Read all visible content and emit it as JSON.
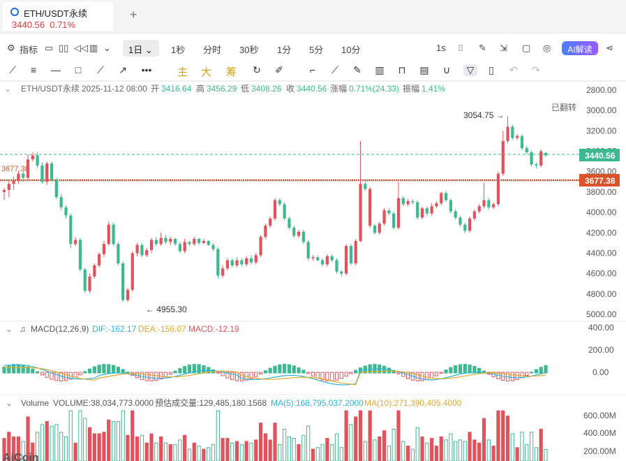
{
  "tab": {
    "title": "ETH/USDT永续",
    "price": "3440.56",
    "change": "0.71%",
    "add": "+"
  },
  "toolbar": {
    "indicators": "指标",
    "day": "1日",
    "intervals": [
      "1秒",
      "分时",
      "30秒",
      "1分",
      "5分",
      "10分"
    ],
    "sec": "1s",
    "ai": "AI解读"
  },
  "drawing": {
    "chars": [
      "主",
      "大",
      "筹"
    ]
  },
  "info": {
    "symbol": "ETH/USDT永续",
    "date": "2025-11-12 08:00",
    "open_l": "开",
    "open": "3416.64",
    "high_l": "高",
    "high": "3456.29",
    "low_l": "低",
    "low": "3408.26",
    "close_l": "收",
    "close": "3440.56",
    "chg_l": "涨幅",
    "chg": "0.71%(24.33)",
    "amp_l": "振幅",
    "amp": "1.41%",
    "flipped": "已翻转"
  },
  "price_axis": [
    "2800.00",
    "3000.00",
    "3200.00",
    "3400.00",
    "3600.00",
    "3800.00",
    "4000.00",
    "4200.00",
    "4400.00",
    "4600.00",
    "4800.00",
    "5000.00"
  ],
  "price_last": "3440.56",
  "price_line": "3677.38",
  "left_line": "3677.38",
  "markers": {
    "high": "3054.75",
    "low": "4955.30"
  },
  "macd": {
    "title": "MACD(12,26,9)",
    "dif": "DIF:-162.17",
    "dea": "DEA:-156.07",
    "macd": "MACD:-12.19",
    "axis": [
      "400.00",
      "200.00",
      "0.00"
    ]
  },
  "volume": {
    "title": "Volume",
    "vol": "VOLUME:38,034,773.0000",
    "est": "预估成交量:129,485,180.1568",
    "ma5": "MA(5):168,795,037.2000",
    "ma10": "MA(10):271,390,405.4000",
    "axis": [
      "600.00M",
      "400.00M",
      "200.00M"
    ]
  },
  "watermark": "AiCoin",
  "colors": {
    "up": "#e0535d",
    "down": "#3eb891",
    "accent": "#d9542b",
    "dif": "#29b6d6",
    "dea": "#e0a92a"
  },
  "chart_data": {
    "type": "candlestick",
    "ylim": [
      2800,
      5000
    ],
    "inverted": true,
    "candles": [
      [
        3800,
        3780,
        3880,
        3760,
        1
      ],
      [
        3780,
        3720,
        3850,
        3690,
        1
      ],
      [
        3720,
        3690,
        3780,
        3650,
        1
      ],
      [
        3690,
        3620,
        3720,
        3590,
        1
      ],
      [
        3620,
        3660,
        3700,
        3600,
        0
      ],
      [
        3660,
        3480,
        3690,
        3430,
        1
      ],
      [
        3480,
        3440,
        3500,
        3410,
        1
      ],
      [
        3440,
        3540,
        3570,
        3410,
        0
      ],
      [
        3540,
        3700,
        3720,
        3510,
        0
      ],
      [
        3700,
        3520,
        3730,
        3500,
        1
      ],
      [
        3520,
        3680,
        3700,
        3500,
        0
      ],
      [
        3680,
        3850,
        3870,
        3660,
        0
      ],
      [
        3850,
        3950,
        3980,
        3820,
        0
      ],
      [
        3950,
        4030,
        4060,
        3930,
        0
      ],
      [
        4030,
        4310,
        4350,
        4010,
        0
      ],
      [
        4310,
        4270,
        4330,
        4240,
        1
      ],
      [
        4270,
        4560,
        4580,
        4250,
        0
      ],
      [
        4560,
        4770,
        4790,
        4540,
        0
      ],
      [
        4770,
        4630,
        4790,
        4600,
        1
      ],
      [
        4630,
        4520,
        4650,
        4500,
        1
      ],
      [
        4520,
        4410,
        4540,
        4390,
        1
      ],
      [
        4410,
        4310,
        4440,
        4280,
        1
      ],
      [
        4310,
        4120,
        4330,
        4090,
        1
      ],
      [
        4120,
        4310,
        4330,
        4100,
        0
      ],
      [
        4310,
        4500,
        4520,
        4290,
        0
      ],
      [
        4500,
        4860,
        4880,
        4480,
        0
      ],
      [
        4860,
        4760,
        4880,
        4740,
        1
      ],
      [
        4760,
        4400,
        4780,
        4380,
        1
      ],
      [
        4400,
        4320,
        4430,
        4300,
        1
      ],
      [
        4320,
        4420,
        4440,
        4300,
        0
      ],
      [
        4420,
        4370,
        4440,
        4350,
        1
      ],
      [
        4370,
        4270,
        4400,
        4250,
        1
      ],
      [
        4270,
        4310,
        4330,
        4240,
        0
      ],
      [
        4310,
        4250,
        4330,
        4200,
        1
      ],
      [
        4250,
        4290,
        4310,
        4220,
        0
      ],
      [
        4290,
        4260,
        4320,
        4240,
        1
      ],
      [
        4260,
        4310,
        4330,
        4250,
        0
      ],
      [
        4310,
        4380,
        4400,
        4290,
        0
      ],
      [
        4380,
        4290,
        4400,
        4260,
        1
      ],
      [
        4290,
        4310,
        4330,
        4280,
        0
      ],
      [
        4310,
        4260,
        4330,
        4240,
        1
      ],
      [
        4260,
        4300,
        4320,
        4250,
        0
      ],
      [
        4300,
        4280,
        4310,
        4260,
        1
      ],
      [
        4280,
        4320,
        4330,
        4270,
        0
      ],
      [
        4320,
        4360,
        4380,
        4300,
        0
      ],
      [
        4360,
        4620,
        4650,
        4340,
        0
      ],
      [
        4620,
        4550,
        4640,
        4520,
        1
      ],
      [
        4550,
        4470,
        4570,
        4450,
        1
      ],
      [
        4470,
        4520,
        4540,
        4450,
        0
      ],
      [
        4520,
        4470,
        4540,
        4440,
        1
      ],
      [
        4470,
        4510,
        4530,
        4450,
        0
      ],
      [
        4510,
        4450,
        4530,
        4430,
        1
      ],
      [
        4450,
        4490,
        4510,
        4420,
        0
      ],
      [
        4490,
        4420,
        4510,
        4400,
        1
      ],
      [
        4420,
        4240,
        4440,
        4220,
        1
      ],
      [
        4240,
        4130,
        4260,
        4110,
        1
      ],
      [
        4130,
        4060,
        4150,
        4040,
        1
      ],
      [
        4060,
        3880,
        4080,
        3860,
        1
      ],
      [
        3880,
        3920,
        3940,
        3860,
        0
      ],
      [
        3920,
        4060,
        4080,
        3900,
        0
      ],
      [
        4060,
        4150,
        4170,
        4040,
        0
      ],
      [
        4150,
        4230,
        4250,
        4130,
        0
      ],
      [
        4230,
        4190,
        4250,
        4170,
        1
      ],
      [
        4190,
        4290,
        4310,
        4170,
        0
      ],
      [
        4290,
        4450,
        4470,
        4270,
        0
      ],
      [
        4450,
        4440,
        4470,
        4420,
        1
      ],
      [
        4440,
        4470,
        4480,
        4420,
        0
      ],
      [
        4470,
        4510,
        4530,
        4450,
        0
      ],
      [
        4510,
        4430,
        4530,
        4410,
        1
      ],
      [
        4430,
        4470,
        4490,
        4410,
        0
      ],
      [
        4470,
        4580,
        4600,
        4450,
        0
      ],
      [
        4580,
        4600,
        4630,
        4570,
        0
      ],
      [
        4600,
        4330,
        4620,
        4310,
        1
      ],
      [
        4330,
        4500,
        4520,
        4310,
        0
      ],
      [
        4500,
        4280,
        4520,
        4260,
        1
      ],
      [
        4280,
        3720,
        3300,
        4290,
        1
      ],
      [
        3720,
        3770,
        3790,
        3690,
        0
      ],
      [
        3770,
        4130,
        4150,
        3750,
        1
      ],
      [
        4130,
        4200,
        4220,
        4110,
        0
      ],
      [
        4200,
        4110,
        4220,
        4090,
        1
      ],
      [
        4110,
        3980,
        4130,
        3960,
        1
      ],
      [
        3980,
        4010,
        4030,
        3960,
        0
      ],
      [
        4010,
        4150,
        4170,
        3990,
        0
      ],
      [
        4150,
        3860,
        4170,
        3700,
        1
      ],
      [
        3860,
        3920,
        3940,
        3840,
        0
      ],
      [
        3920,
        3890,
        3940,
        3870,
        1
      ],
      [
        3890,
        3900,
        3920,
        3870,
        0
      ],
      [
        3900,
        4050,
        4070,
        3880,
        0
      ],
      [
        4050,
        3960,
        4070,
        3940,
        1
      ],
      [
        3960,
        4010,
        4030,
        3940,
        0
      ],
      [
        4010,
        3940,
        4030,
        3910,
        1
      ],
      [
        3940,
        3910,
        3960,
        3890,
        1
      ],
      [
        3910,
        3810,
        3930,
        3800,
        1
      ],
      [
        3810,
        3880,
        3900,
        3790,
        0
      ],
      [
        3880,
        3990,
        4010,
        3860,
        0
      ],
      [
        3990,
        4050,
        4070,
        3970,
        0
      ],
      [
        4050,
        4120,
        4140,
        4030,
        0
      ],
      [
        4120,
        4180,
        4200,
        4100,
        0
      ],
      [
        4180,
        4060,
        4200,
        4040,
        1
      ],
      [
        4060,
        3990,
        4080,
        3970,
        1
      ],
      [
        3990,
        3940,
        4010,
        3920,
        1
      ],
      [
        3940,
        3880,
        3960,
        3710,
        1
      ],
      [
        3880,
        3950,
        3970,
        3860,
        0
      ],
      [
        3950,
        3920,
        3970,
        3900,
        1
      ],
      [
        3920,
        3620,
        3940,
        3600,
        1
      ],
      [
        3620,
        3300,
        3640,
        3200,
        1
      ],
      [
        3300,
        3160,
        3320,
        3054.75,
        1
      ],
      [
        3160,
        3270,
        3290,
        3140,
        0
      ],
      [
        3270,
        3250,
        3290,
        3230,
        1
      ],
      [
        3250,
        3370,
        3390,
        3230,
        0
      ],
      [
        3370,
        3410,
        3430,
        3350,
        0
      ],
      [
        3410,
        3530,
        3550,
        3390,
        0
      ],
      [
        3530,
        3540,
        3570,
        3510,
        0
      ],
      [
        3540,
        3400,
        3560,
        3380,
        1
      ],
      [
        3416.64,
        3440.56,
        3456.29,
        3408.26,
        0
      ]
    ]
  }
}
